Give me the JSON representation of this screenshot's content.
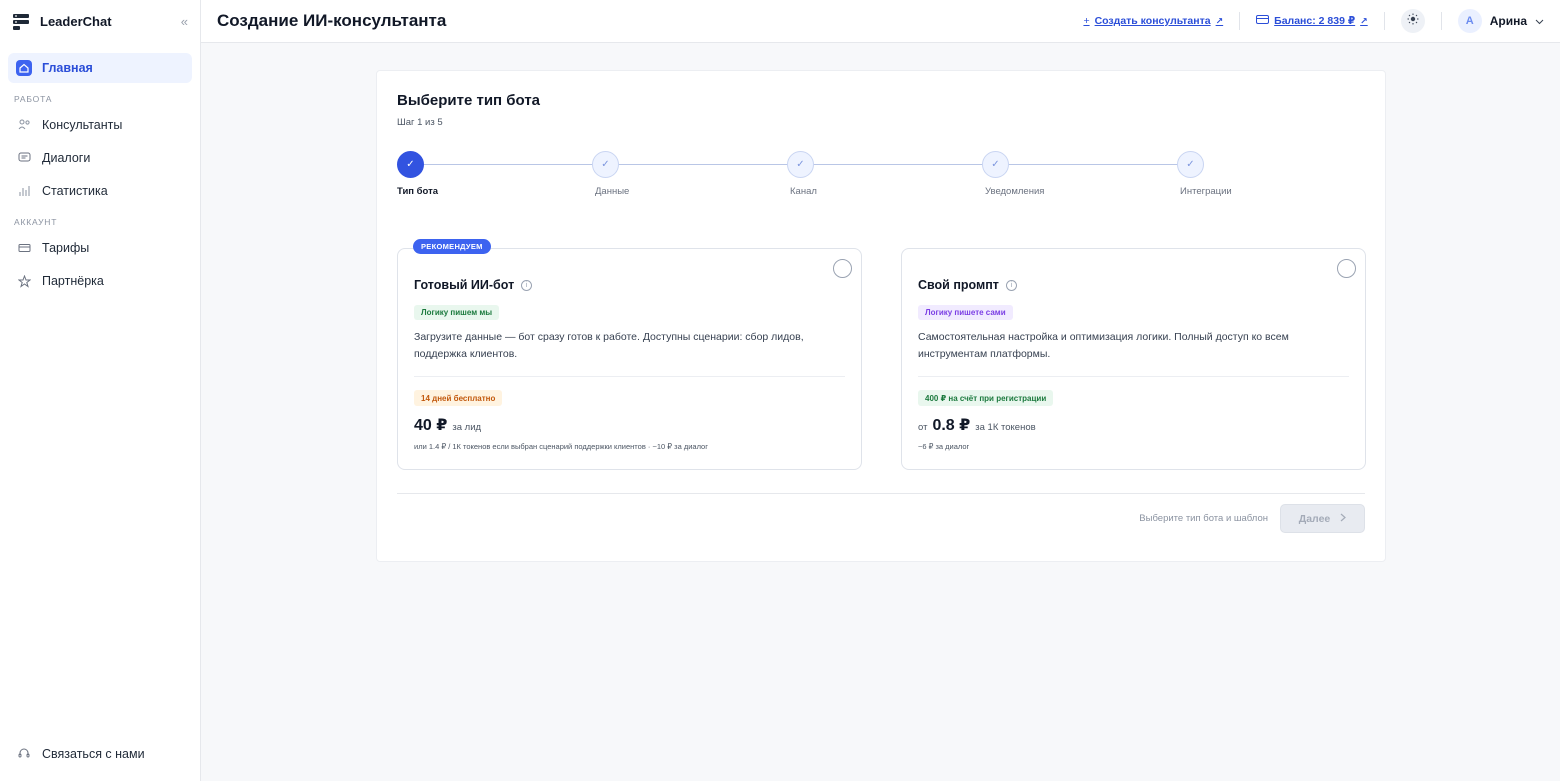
{
  "app": {
    "name": "LeaderChat",
    "collapse_icon": "«"
  },
  "sidebar": {
    "home": "Главная",
    "section_work": "РАБОТА",
    "work_items": [
      "Консультанты",
      "Диалоги",
      "Статистика"
    ],
    "section_account": "АККАУНТ",
    "account_items": [
      "Тарифы",
      "Партнёрка"
    ],
    "contact": "Связаться с нами"
  },
  "header": {
    "title": "Создание ИИ-консультанта",
    "create_link": "Создать консультанта",
    "balance_link": "Баланс: 2 839 ₽",
    "user_initial": "A",
    "user_name": "Арина"
  },
  "wizard": {
    "title": "Выберите тип бота",
    "step_info": "Шаг 1 из 5",
    "steps": [
      "Тип бота",
      "Данные",
      "Канал",
      "Уведомления",
      "Интеграции"
    ],
    "active_step": 0,
    "options": [
      {
        "badge": "РЕКОМЕНДУЕМ",
        "title": "Готовый ИИ-бот",
        "tag": "Логику пишем мы",
        "description": "Загрузите данные — бот сразу готов к работе. Доступны сценарии: сбор лидов, поддержка клиентов.",
        "offer": "14 дней бесплатно",
        "price_prefix": "",
        "price": "40 ₽",
        "price_unit": "за лид",
        "price_note": "или 1.4 ₽ / 1К токенов если выбран сценарий поддержки клиентов · ~10 ₽ за диалог"
      },
      {
        "title": "Свой промпт",
        "tag": "Логику пишете сами",
        "description": "Самостоятельная настройка и оптимизация логики. Полный доступ ко всем инструментам платформы.",
        "offer": "400 ₽ на счёт при регистрации",
        "price_prefix": "от",
        "price": "0.8 ₽",
        "price_unit": "за 1К токенов",
        "price_note": "~6 ₽ за диалог"
      }
    ],
    "hint": "Выберите тип бота и шаблон",
    "next_label": "Далее"
  },
  "colors": {
    "accent": "#3d63f0",
    "link": "#2b4ed8"
  }
}
